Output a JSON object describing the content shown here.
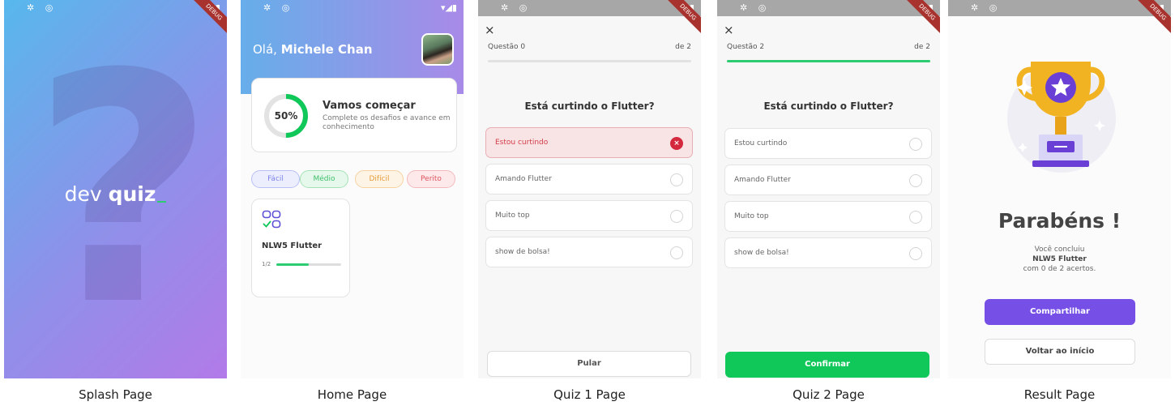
{
  "captions": {
    "splash": "Splash Page",
    "home": "Home Page",
    "quiz1": "Quiz 1 Page",
    "quiz2": "Quiz 2 Page",
    "result": "Result Page"
  },
  "status_bar": {
    "left_icons": "✲ ◎",
    "right_icons": "▾◢▮",
    "debug_ribbon": "DEBUG"
  },
  "splash": {
    "logo_light": "dev",
    "logo_bold": "quiz",
    "bg_glyph": "?"
  },
  "home": {
    "greeting_prefix": "Olá, ",
    "user_name": "Michele Chan",
    "score_card": {
      "percent_label": "50%",
      "percent_value": 0.5,
      "title": "Vamos começar",
      "subtitle": "Complete os desafios e avance em conhecimento"
    },
    "levels": [
      "Fácil",
      "Médio",
      "Difícil",
      "Perito"
    ],
    "quiz_card": {
      "title": "NLW5 Flutter",
      "progress_label": "1/2",
      "progress_value": 0.5
    }
  },
  "quiz1": {
    "close": "×",
    "progress_left": "Questão 0",
    "progress_right": "de 2",
    "progress_value": 0,
    "question": "Está curtindo o Flutter?",
    "options": [
      "Estou curtindo",
      "Amando Flutter",
      "Muito top",
      "show de bolsa!"
    ],
    "wrong_mark": "×",
    "skip_label": "Pular"
  },
  "quiz2": {
    "close": "×",
    "progress_left": "Questão 2",
    "progress_right": "de 2",
    "progress_value": 1,
    "question": "Está curtindo o Flutter?",
    "options": [
      "Estou curtindo",
      "Amando Flutter",
      "Muito top",
      "show de bolsa!"
    ],
    "confirm_label": "Confirmar"
  },
  "result": {
    "title": "Parabéns !",
    "line1": "Você concluiu",
    "line2": "NLW5 Flutter",
    "line3": "com 0 de 2 acertos.",
    "share_label": "Compartilhar",
    "back_label": "Voltar ao início"
  },
  "colors": {
    "accent_green": "#10c75a",
    "accent_purple": "#7650e6",
    "wrong_red": "#d4283f"
  }
}
